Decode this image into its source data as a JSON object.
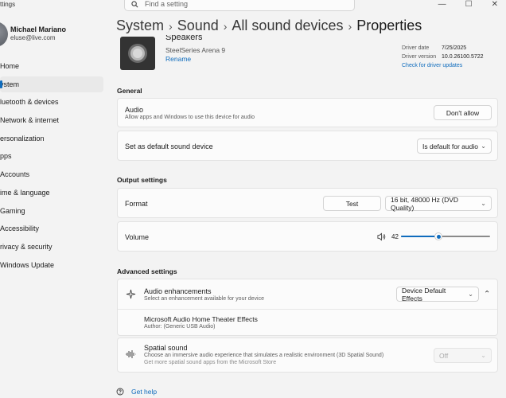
{
  "window": {
    "title": "ttings"
  },
  "search": {
    "placeholder": "Find a setting"
  },
  "window_controls": {
    "minimize": "—",
    "maximize": "☐",
    "close": "✕"
  },
  "user": {
    "name": "Michael Mariano",
    "email": "eluse@live.com"
  },
  "sidebar": {
    "items": [
      {
        "label": "Home"
      },
      {
        "label": "ystem",
        "active": true
      },
      {
        "label": "luetooth & devices"
      },
      {
        "label": "Network & internet"
      },
      {
        "label": "ersonalization"
      },
      {
        "label": "pps"
      },
      {
        "label": "Accounts"
      },
      {
        "label": "ime & language"
      },
      {
        "label": "Gaming"
      },
      {
        "label": "Accessibility"
      },
      {
        "label": "rivacy & security"
      },
      {
        "label": "Windows Update"
      }
    ]
  },
  "breadcrumb": {
    "items": [
      "System",
      "Sound",
      "All sound devices"
    ],
    "current": "Properties",
    "separator": "›"
  },
  "device": {
    "name": "Speakers",
    "model": "SteelSeries Arena 9",
    "rename": "Rename",
    "driver_date_label": "Driver date",
    "driver_date": "7/25/2025",
    "driver_version_label": "Driver version",
    "driver_version": "10.0.26100.5722",
    "check_updates": "Check for driver updates"
  },
  "general": {
    "title": "General",
    "audio_title": "Audio",
    "audio_sub": "Allow apps and Windows to use this device for audio",
    "audio_button": "Don't allow",
    "default_title": "Set as default sound device",
    "default_value": "Is default for audio"
  },
  "output": {
    "title": "Output settings",
    "format_label": "Format",
    "test_button": "Test",
    "format_value": "16 bit, 48000 Hz (DVD Quality)",
    "volume_label": "Volume",
    "volume_value": "42",
    "volume_fraction": 0.42
  },
  "advanced": {
    "title": "Advanced settings",
    "enh_title": "Audio enhancements",
    "enh_sub": "Select an enhancement available for your device",
    "enh_value": "Device Default Effects",
    "ms_title": "Microsoft Audio Home Theater Effects",
    "ms_author": "Author: (Generic USB Audio)",
    "spatial_title": "Spatial sound",
    "spatial_sub": "Choose an immersive audio experience that simulates a realistic environment (3D Spatial Sound)",
    "spatial_link": "Get more spatial sound apps from the Microsoft Store",
    "spatial_value": "Off"
  },
  "help": {
    "label": "Get help"
  },
  "colors": {
    "accent": "#0f6cbd",
    "background": "#f3f3f3",
    "card": "#fbfbfb"
  }
}
